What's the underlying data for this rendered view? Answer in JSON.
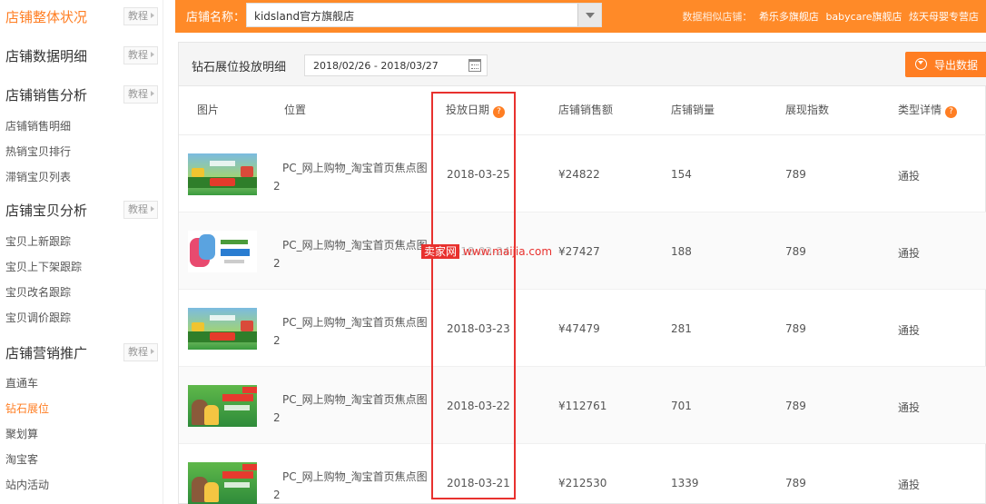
{
  "sidebar": {
    "tutorial_label": "教程",
    "sections": [
      {
        "title": "店铺整体状况",
        "active": true
      },
      {
        "title": "店铺数据明细",
        "active": false
      },
      {
        "title": "店铺销售分析",
        "active": false,
        "items": [
          "店铺销售明细",
          "热销宝贝排行",
          "滞销宝贝列表"
        ]
      },
      {
        "title": "店铺宝贝分析",
        "active": false,
        "items": [
          "宝贝上新跟踪",
          "宝贝上下架跟踪",
          "宝贝改名跟踪",
          "宝贝调价跟踪"
        ]
      },
      {
        "title": "店铺营销推广",
        "active": false,
        "items": [
          "直通车",
          "钻石展位",
          "聚划算",
          "淘宝客",
          "站内活动"
        ],
        "active_item": 1
      }
    ]
  },
  "topbar": {
    "shop_label": "店铺名称：",
    "shop_value": "kidsland官方旗舰店",
    "similar_label": "数据相似店铺：",
    "similar_shops": [
      "希乐多旗舰店",
      "babycare旗舰店",
      "炫天母婴专营店"
    ]
  },
  "panel": {
    "title": "钻石展位投放明细",
    "date_range": "2018/02/26 - 2018/03/27",
    "export_label": "导出数据"
  },
  "table": {
    "headers": [
      "图片",
      "位置",
      "投放日期",
      "店铺销售额",
      "店铺销量",
      "展现指数",
      "类型详情"
    ],
    "rows": [
      {
        "thumb": "kids1",
        "position": "PC_网上购物_淘宝首页焦点图",
        "position_suffix": "2",
        "date": "2018-03-25",
        "sales": "¥24822",
        "volume": "154",
        "index": "789",
        "type": "通投"
      },
      {
        "thumb": "kids2",
        "position": "PC_网上购物_淘宝首页焦点图",
        "position_suffix": "2",
        "date": "2018-03-24",
        "sales": "¥27427",
        "volume": "188",
        "index": "789",
        "type": "通投"
      },
      {
        "thumb": "kids1",
        "position": "PC_网上购物_淘宝首页焦点图",
        "position_suffix": "2",
        "date": "2018-03-23",
        "sales": "¥47479",
        "volume": "281",
        "index": "789",
        "type": "通投"
      },
      {
        "thumb": "kids3",
        "position": "PC_网上购物_淘宝首页焦点图",
        "position_suffix": "2",
        "date": "2018-03-22",
        "sales": "¥112761",
        "volume": "701",
        "index": "789",
        "type": "通投"
      },
      {
        "thumb": "kids3",
        "position": "PC_网上购物_淘宝首页焦点图",
        "position_suffix": "2",
        "date": "2018-03-21",
        "sales": "¥212530",
        "volume": "1339",
        "index": "789",
        "type": "通投"
      }
    ]
  },
  "watermark": {
    "badge": "卖家网",
    "url": "www.maijia.com"
  },
  "colors": {
    "accent": "#ff8a28",
    "highlight": "#e8312e"
  }
}
